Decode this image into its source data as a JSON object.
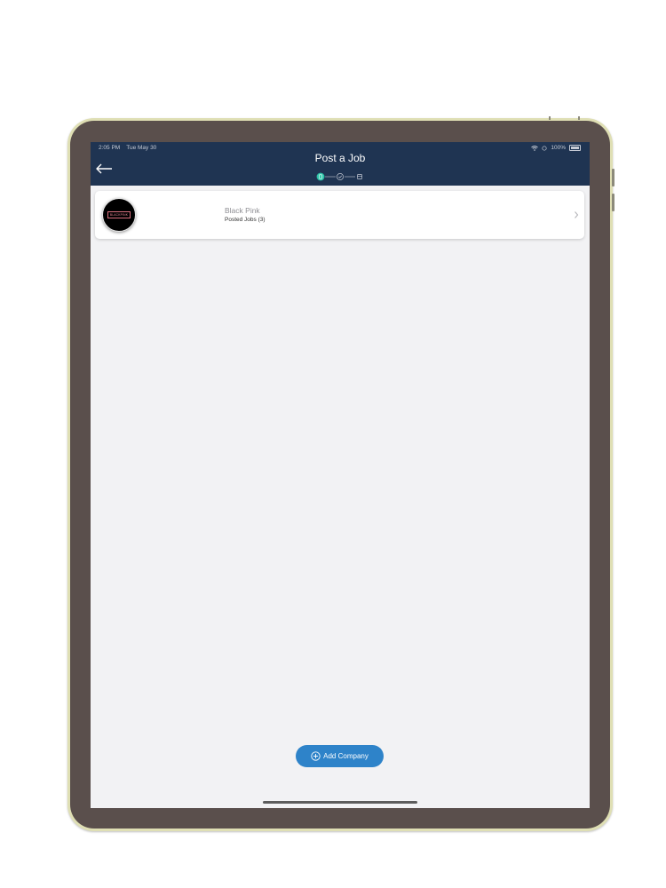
{
  "status_bar": {
    "time": "2:05 PM",
    "date": "Tue May 30",
    "battery": "100%",
    "wifi_icon": "wifi-icon",
    "battery_icon": "battery-icon"
  },
  "nav": {
    "title": "Post a Job",
    "back_icon": "arrow-left-icon",
    "steps": [
      "info-icon",
      "check-icon",
      "document-icon"
    ],
    "active_step": 0
  },
  "companies": [
    {
      "name": "Black Pink",
      "posted_jobs": "Posted Jobs (3)",
      "logo_text": "BLACKPINK"
    }
  ],
  "add_company": {
    "label": "Add Company",
    "icon": "plus-circle-icon"
  },
  "colors": {
    "nav_background": "#1f3452",
    "accent": "#2e83c9",
    "active_step": "#2ec4a9",
    "screen_background": "#f2f2f4",
    "device_frame": "#5a4f4c"
  }
}
